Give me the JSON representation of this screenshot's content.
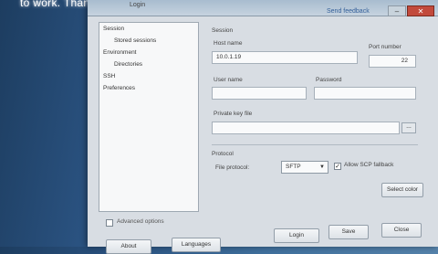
{
  "overlay_caption": "to work. Thanks!",
  "window": {
    "title": "Login",
    "support_link": "Send feedback"
  },
  "tree": {
    "items": [
      {
        "label": "Session"
      },
      {
        "label": "Stored sessions"
      },
      {
        "label": "Environment"
      },
      {
        "label": "Directories"
      },
      {
        "label": "SSH"
      },
      {
        "label": "Preferences"
      }
    ],
    "advanced_label": "Advanced options"
  },
  "session": {
    "group_label": "Session",
    "host_name_label": "Host name",
    "host_name_value": "10.0.1.19",
    "port_label": "Port number",
    "port_value": "22",
    "user_name_label": "User name",
    "user_name_value": "",
    "password_label": "Password",
    "password_value": "",
    "private_key_label": "Private key file",
    "private_key_value": ""
  },
  "protocol": {
    "group_label": "Protocol",
    "file_protocol_label": "File protocol:",
    "file_protocol_value": "SFTP",
    "allow_scp_fallback_label": "Allow SCP fallback",
    "allow_scp_fallback_checked": true,
    "select_color_label": "Select color"
  },
  "buttons": {
    "login": "Login",
    "save": "Save",
    "close": "Close",
    "about": "About",
    "languages": "Languages"
  },
  "icons": {
    "minimize": "minimize-icon",
    "close": "close-icon",
    "browse": "ellipsis-icon",
    "dropdown": "chevron-down-icon"
  }
}
